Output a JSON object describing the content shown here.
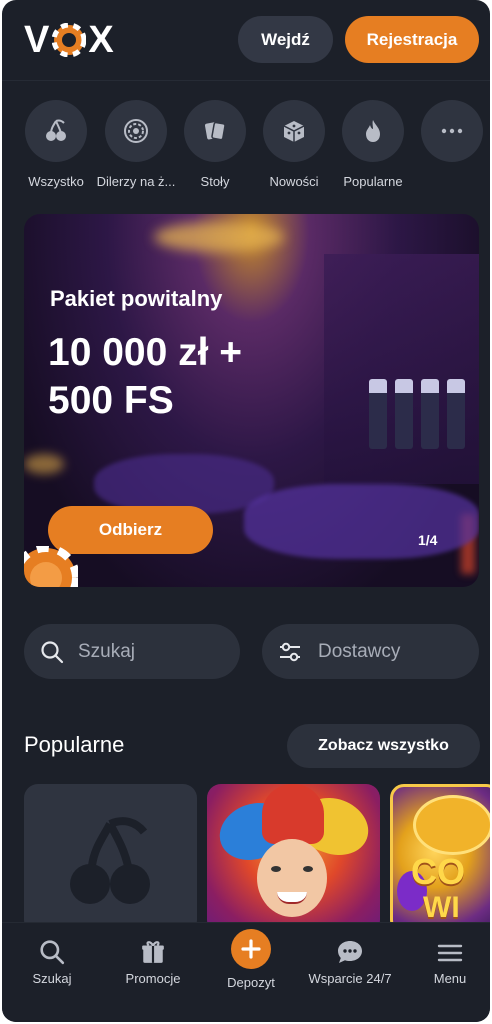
{
  "header": {
    "logo_text_left": "V",
    "logo_text_right": "X",
    "login_label": "Wejdź",
    "register_label": "Rejestracja"
  },
  "categories": [
    {
      "label": "Wszystko",
      "icon": "cherry-icon"
    },
    {
      "label": "Dilerzy na ż...",
      "icon": "roulette-icon"
    },
    {
      "label": "Stoły",
      "icon": "cards-icon"
    },
    {
      "label": "Nowości",
      "icon": "dice-icon"
    },
    {
      "label": "Popularne",
      "icon": "flame-icon"
    },
    {
      "label": "",
      "icon": "more-icon"
    }
  ],
  "banner": {
    "title": "Pakiet powitalny",
    "amount_line1": "10 000 zł +",
    "amount_line2": "500 FS",
    "claim_label": "Odbierz",
    "pager": "1/4"
  },
  "search": {
    "placeholder": "Szukaj"
  },
  "providers": {
    "label": "Dostawcy"
  },
  "popular": {
    "title": "Popularne",
    "see_all_label": "Zobacz wszystko"
  },
  "bottom_nav": [
    {
      "label": "Szukaj",
      "icon": "search-icon"
    },
    {
      "label": "Promocje",
      "icon": "gift-icon"
    },
    {
      "label": "Depozyt",
      "icon": "plus-icon"
    },
    {
      "label": "Wsparcie 24/7",
      "icon": "chat-icon"
    },
    {
      "label": "Menu",
      "icon": "menu-icon"
    }
  ],
  "colors": {
    "background": "#1c2029",
    "accent": "#e67e22",
    "surface": "#2c313c"
  }
}
